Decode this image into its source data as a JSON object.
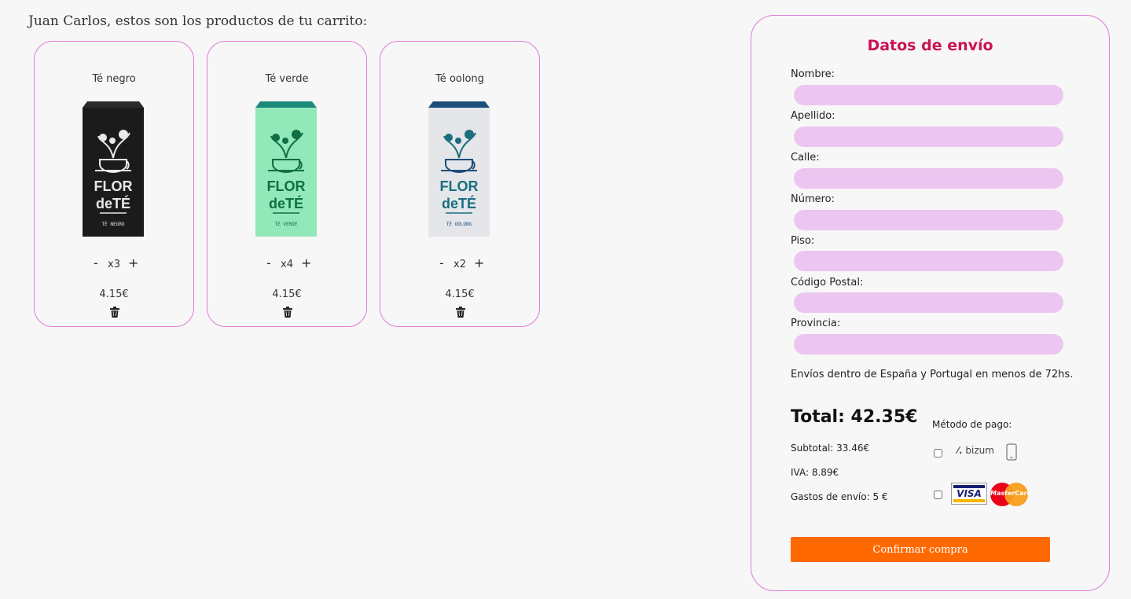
{
  "greeting": "Juan Carlos, estos son los productos de tu carrito:",
  "products": [
    {
      "name": "Té negro",
      "qty": "x3",
      "price": "4.15€",
      "pack_color": "#1b1b1b",
      "cap_color": "#2a2a2a",
      "ink_color": "#e8e8e8",
      "label": "TÉ NEGRO"
    },
    {
      "name": "Té verde",
      "qty": "x4",
      "price": "4.15€",
      "pack_color": "#92e8b8",
      "cap_color": "#1b8a7a",
      "ink_color": "#0f6e44",
      "label": "TÉ VERDE"
    },
    {
      "name": "Té oolong",
      "qty": "x2",
      "price": "4.15€",
      "pack_color": "#e4e6e9",
      "cap_color": "#1d4e7a",
      "ink_color": "#1a6e7e",
      "label": "TÉ OOLONG"
    }
  ],
  "controls": {
    "minus": "-",
    "plus": "+"
  },
  "brand": {
    "line1": "FLOR",
    "line2": "deTÉ"
  },
  "shipping": {
    "title": "Datos de envío",
    "fields": [
      "Nombre:",
      "Apellido:",
      "Calle:",
      "Número:",
      "Piso:",
      "Código Postal:",
      "Provincia:"
    ],
    "note": "Envíos dentro de España y Portugal en menos de 72hs."
  },
  "summary": {
    "total": "Total: 42.35€",
    "subtotal": "Subtotal: 33.46€",
    "iva": "IVA: 8.89€",
    "envio": "Gastos de envío: 5 €"
  },
  "payment": {
    "title": "Método de pago:",
    "bizum": "bizum",
    "visa": "VISA",
    "mastercard": "MasterCard"
  },
  "confirm_label": "Confirmar compra",
  "colors": {
    "accent": "#cc1155",
    "border": "#e07ad8",
    "input_bg": "#ecc6f0",
    "button": "#ff6a00"
  }
}
